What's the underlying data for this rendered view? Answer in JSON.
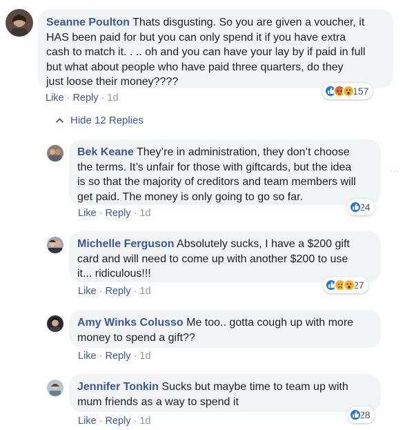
{
  "comments": [
    {
      "author": "Seanne Poulton",
      "lines": [
        "Thats disgusting. So you are given a voucher, it",
        "HAS been paid for but you can only spend it if you have extra",
        "cash to match it. . .. oh and you can have your lay by if paid in full",
        "but what about people who have paid three quarters, do they",
        "just loose their money????"
      ],
      "like": "Like",
      "reply": "Reply",
      "time": "1d",
      "reaction_count": "157",
      "reaction_icons": [
        "like-icon",
        "angry-icon",
        "wow-icon"
      ]
    }
  ],
  "hide_replies_label": "Hide 12 Replies",
  "replies": [
    {
      "author": "Bek Keane",
      "lines": [
        "They’re in administration, they don’t choose",
        "the terms. It’s unfair for those with giftcards, but the idea",
        "is so that the majority of creditors and team members will",
        "get paid. The money is only going to go so far."
      ],
      "like": "Like",
      "reply": "Reply",
      "time": "1d",
      "reaction_count": "24",
      "reaction_icons": [
        "like-icon"
      ]
    },
    {
      "author": "Michelle Ferguson",
      "lines": [
        "Absolutely sucks, I have a $200 gift",
        "card and will need to come up with another $200 to use",
        "it... ridiculous!!!"
      ],
      "like": "Like",
      "reply": "Reply",
      "time": "1d",
      "reaction_count": "27",
      "reaction_icons": [
        "like-icon",
        "sad-icon",
        "wow-icon"
      ]
    },
    {
      "author": "Amy Winks Colusso",
      "lines": [
        "Me too.. gotta cough up with more",
        "money to spend a gift??"
      ],
      "like": "Like",
      "reply": "Reply",
      "time": "1d",
      "reaction_count": "",
      "reaction_icons": []
    },
    {
      "author": "Jennifer Tonkin",
      "lines": [
        "Sucks but maybe time to team up with",
        "mum friends as a way to spend it"
      ],
      "like": "Like",
      "reply": "Reply",
      "time": "1d",
      "reaction_count": "28",
      "reaction_icons": [
        "like-icon"
      ]
    }
  ],
  "more_options": "···",
  "colors": {
    "link": "#385898",
    "bubble": "#f2f3f5",
    "like_blue": "#1877f2",
    "angry": "#e9710f",
    "wow": "#f7b125"
  }
}
